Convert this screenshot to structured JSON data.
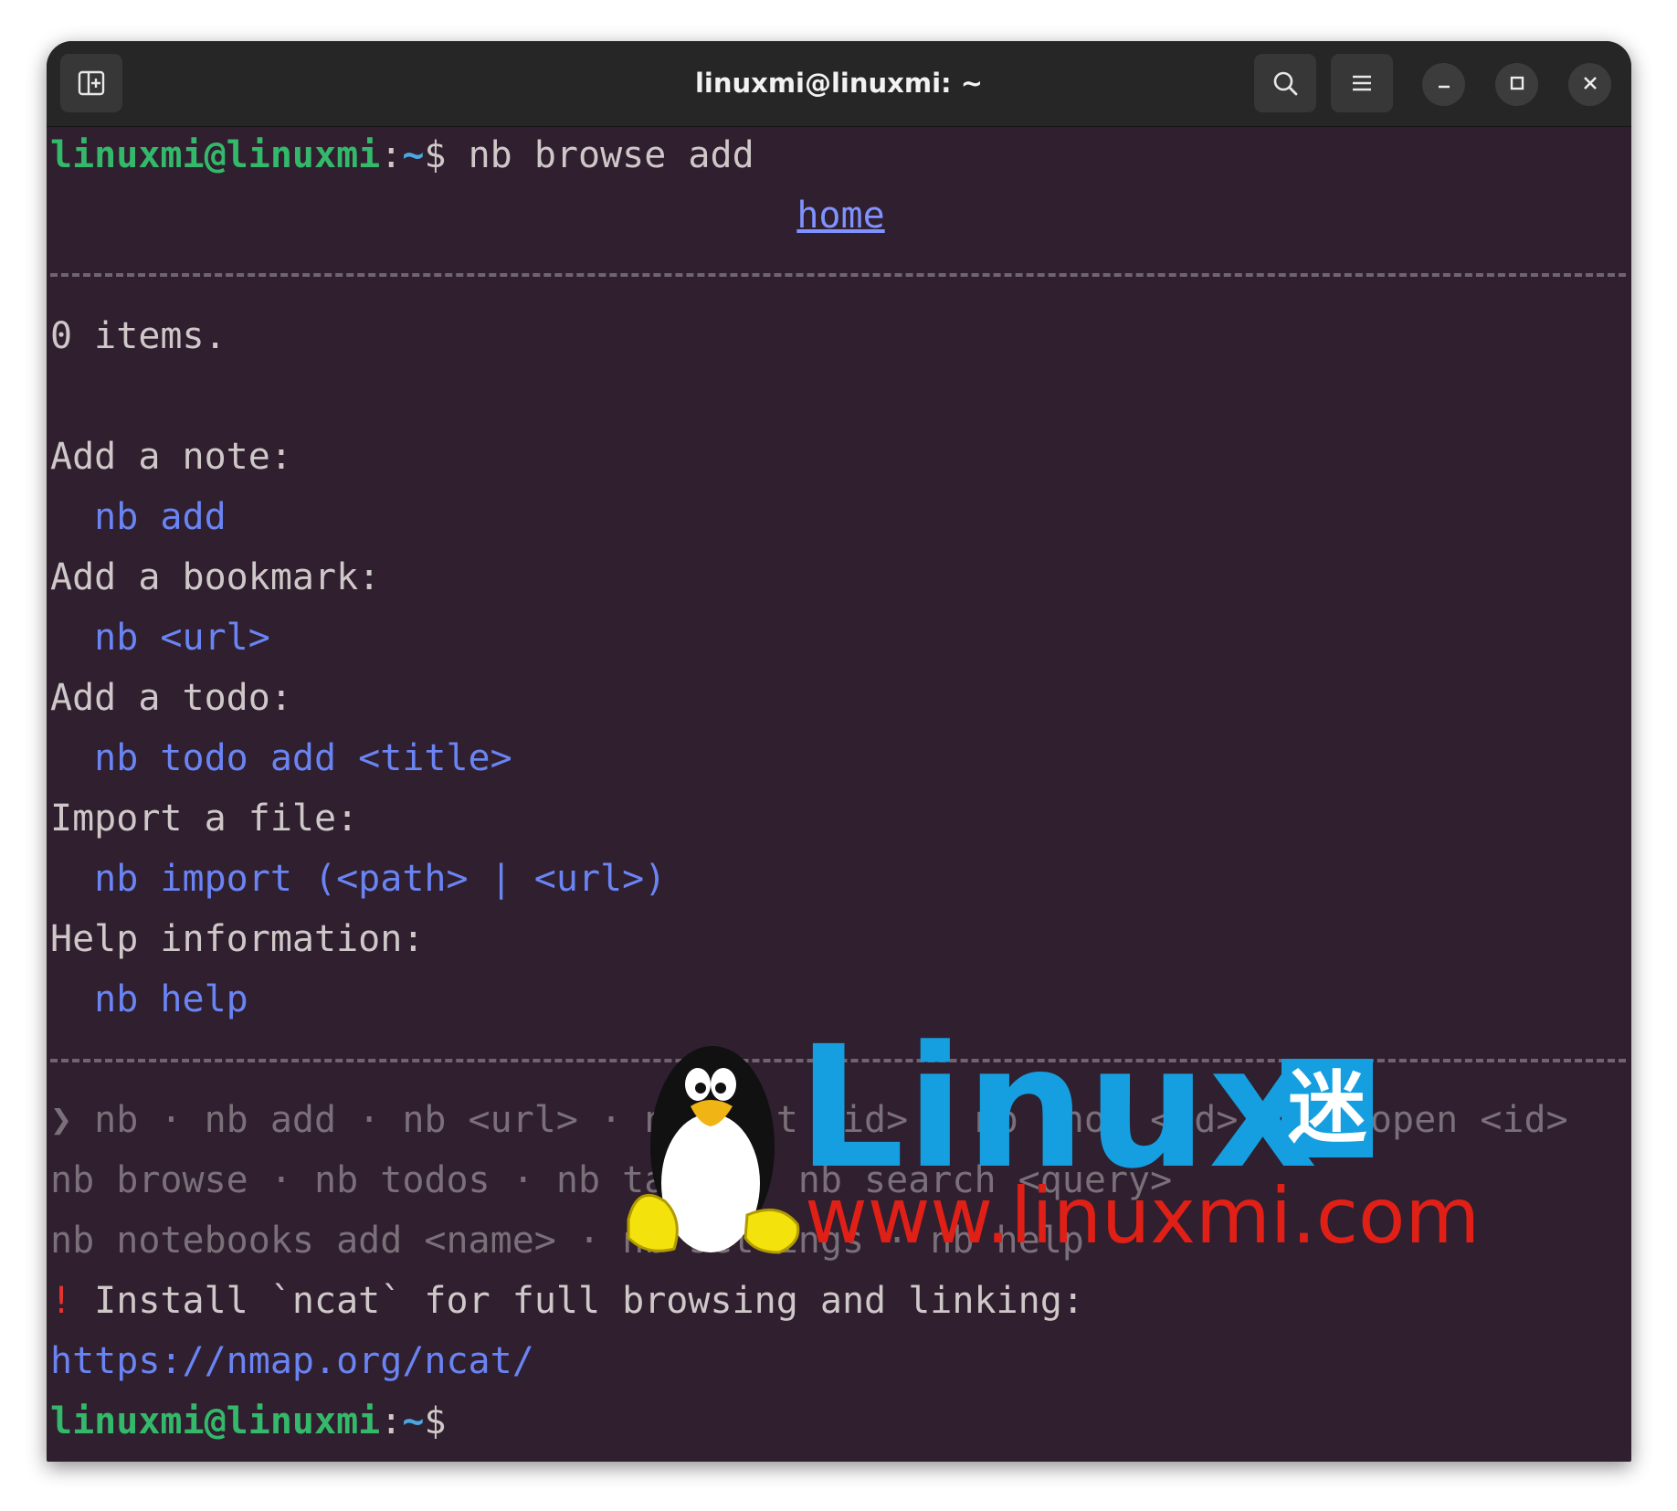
{
  "window": {
    "title": "linuxmi@linuxmi: ~",
    "buttons": {
      "new_tab": "new-tab-icon",
      "search": "search-icon",
      "menu": "hamburger-menu-icon",
      "minimize": "minimize-icon",
      "maximize": "maximize-icon",
      "close": "close-icon"
    }
  },
  "terminal": {
    "prompt_user": "linuxmi@linuxmi",
    "prompt_sep": ":",
    "prompt_path": "~",
    "prompt_symbol": "$",
    "command": " nb browse add",
    "header_link": "home",
    "items_count": "0 items.",
    "sections": [
      {
        "label": "Add a note:",
        "command": "  nb add"
      },
      {
        "label": "Add a bookmark:",
        "command": "  nb <url>"
      },
      {
        "label": "Add a todo:",
        "command": "  nb todo add <title>"
      },
      {
        "label": "Import a file:",
        "command": "  nb import (<path> | <url>)"
      },
      {
        "label": "Help information:",
        "command": "  nb help"
      }
    ],
    "footer": [
      "❯ nb · nb add · nb <url> · nb edit <id> · nb show <id> · nb open <id>",
      "nb browse · nb todos · nb tasks · nb search <query>",
      "nb notebooks add <name> · nb settings · nb help"
    ],
    "warning_mark": "!",
    "warning_text": " Install `ncat` for full browsing and linking:",
    "warning_url": "https://nmap.org/ncat/"
  },
  "watermark": {
    "brand": "Linux",
    "brand_cn": "迷",
    "url": "www.linuxmi.com"
  },
  "colors": {
    "terminal_bg": "#2f1f2f",
    "titlebar_bg": "#262626",
    "prompt_user": "#34b86a",
    "prompt_path": "#4aa7df",
    "command_blue": "#6a84f3",
    "warning_red": "#e2352d",
    "watermark_blue": "#159fe0",
    "watermark_red": "#e02016"
  }
}
